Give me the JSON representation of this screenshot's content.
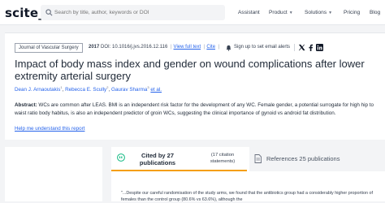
{
  "brand": {
    "logo_text": "scite_"
  },
  "search": {
    "placeholder": "Search by title, author, keywords or DOI"
  },
  "nav": {
    "assistant": "Assistant",
    "product": "Product",
    "solutions": "Solutions",
    "pricing": "Pricing",
    "blog": "Blog"
  },
  "article": {
    "journal": "Journal of Vascular Surgery",
    "year": "2017",
    "doi": "DOI: 10.1016/j.jvs.2016.12.116",
    "view_full_text": "View full text",
    "cite": "Cite",
    "sign_in": "Sign up to set email alerts",
    "title": "Impact of body mass index and gender on wound complications after lower extremity arterial surgery",
    "authors": [
      {
        "name": "Dean J. Arnaoutakis",
        "sup": "1"
      },
      {
        "name": "Rebecca E. Scully",
        "sup": "2"
      },
      {
        "name": "Gaurav Sharma",
        "sup": "3"
      }
    ],
    "et_al": "et al.",
    "abstract_label": "Abstract:",
    "abstract_text": "WCs are common after LEAS. BMI is an independent risk factor for the development of any WC. Female gender, a potential surrogate for high hip to waist ratio body habitus, is also an independent predictor of groin WCs, suggesting the clinical importance of gynoid vs android fat distribution.",
    "help_link": "Help me understand this report"
  },
  "citations": {
    "cited_by": "Cited by 27 publications",
    "cited_sub": "(17 citation statements)",
    "references": "References 25 publications",
    "snippet": "\"...Despite our careful randomisation of the study arms, we found that the antibiotics group had a considerably higher proportion of females than the control group (80.6% vs 63.6%), although the"
  },
  "icons": [
    "search-icon",
    "chevron-down-icon",
    "bell-icon",
    "twitter-icon",
    "facebook-icon",
    "linkedin-icon",
    "quote-icon",
    "document-icon"
  ],
  "colors": {
    "link": "#2563eb",
    "accent": "#f59e0b",
    "quote_green": "#10b981"
  }
}
